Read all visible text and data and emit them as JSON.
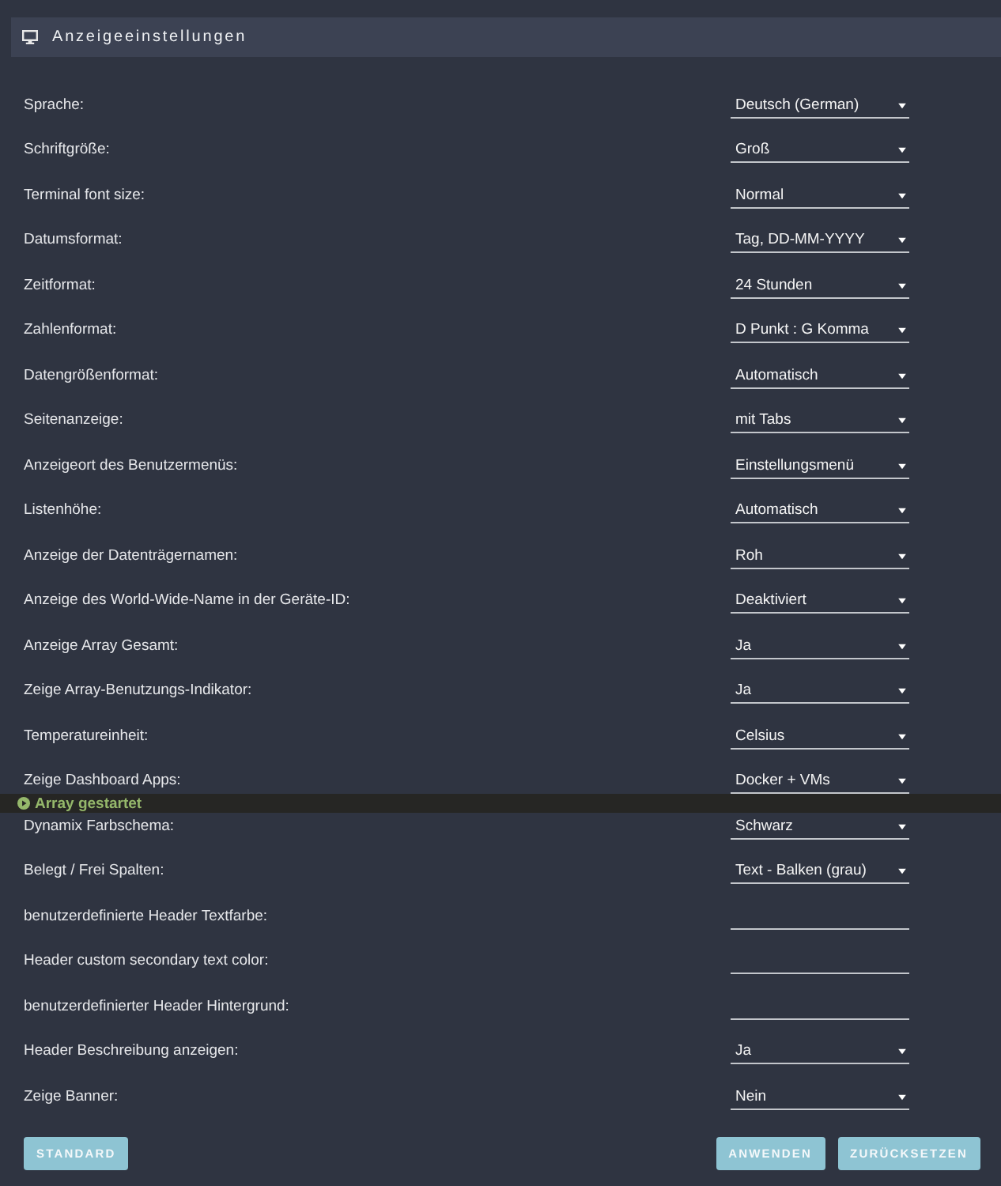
{
  "section": {
    "title": "Anzeigeeinstellungen"
  },
  "settings": [
    {
      "label": "Sprache:",
      "kind": "select",
      "value": "Deutsch (German)"
    },
    {
      "label": "Schriftgröße:",
      "kind": "select",
      "value": "Groß"
    },
    {
      "label": "Terminal font size:",
      "kind": "select",
      "value": "Normal"
    },
    {
      "label": "Datumsformat:",
      "kind": "select",
      "value": "Tag, DD-MM-YYYY"
    },
    {
      "label": "Zeitformat:",
      "kind": "select",
      "value": "24 Stunden"
    },
    {
      "label": "Zahlenformat:",
      "kind": "select",
      "value": "D Punkt : G Komma"
    },
    {
      "label": "Datengrößenformat:",
      "kind": "select",
      "value": "Automatisch"
    },
    {
      "label": "Seitenanzeige:",
      "kind": "select",
      "value": "mit Tabs"
    },
    {
      "label": "Anzeigeort des Benutzermenüs:",
      "kind": "select",
      "value": "Einstellungsmenü"
    },
    {
      "label": "Listenhöhe:",
      "kind": "select",
      "value": "Automatisch"
    },
    {
      "label": "Anzeige der Datenträgernamen:",
      "kind": "select",
      "value": "Roh"
    },
    {
      "label": "Anzeige des World-Wide-Name in der Geräte-ID:",
      "kind": "select",
      "value": "Deaktiviert"
    },
    {
      "label": "Anzeige Array Gesamt:",
      "kind": "select",
      "value": "Ja"
    },
    {
      "label": "Zeige Array-Benutzungs-Indikator:",
      "kind": "select",
      "value": "Ja"
    },
    {
      "label": "Temperatureinheit:",
      "kind": "select",
      "value": "Celsius"
    },
    {
      "label": "Zeige Dashboard Apps:",
      "kind": "select",
      "value": "Docker + VMs"
    },
    {
      "label": "Dynamix Farbschema:",
      "kind": "select",
      "value": "Schwarz"
    },
    {
      "label": "Belegt / Frei Spalten:",
      "kind": "select",
      "value": "Text - Balken (grau)"
    },
    {
      "label": "benutzerdefinierte Header Textfarbe:",
      "kind": "text"
    },
    {
      "label": "Header custom secondary text color:",
      "kind": "text"
    },
    {
      "label": "benutzerdefinierter Header Hintergrund:",
      "kind": "text"
    },
    {
      "label": "Header Beschreibung anzeigen:",
      "kind": "select",
      "value": "Ja"
    },
    {
      "label": "Zeige Banner:",
      "kind": "select",
      "value": "Nein"
    }
  ],
  "status_bar": {
    "text": "Array gestartet"
  },
  "footer": {
    "default_button": "STANDARD",
    "apply_button": "ANWENDEN",
    "reset_button": "ZURÜCKSETZEN"
  }
}
